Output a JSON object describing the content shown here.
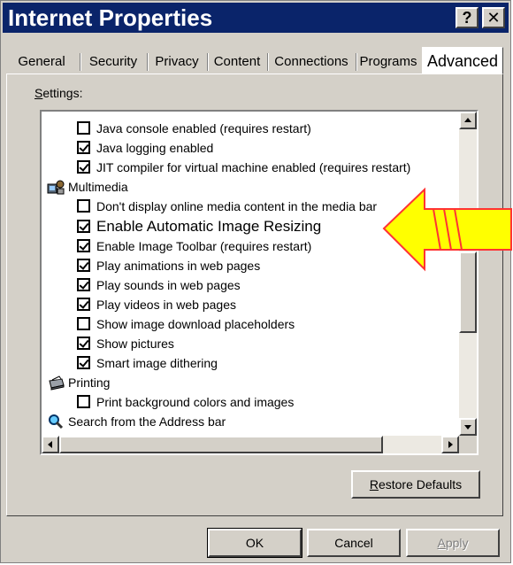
{
  "window": {
    "title": "Internet Properties",
    "help_glyph": "?",
    "close_glyph": "✕"
  },
  "tabs": [
    {
      "label": "General"
    },
    {
      "label": "Security"
    },
    {
      "label": "Privacy"
    },
    {
      "label": "Content"
    },
    {
      "label": "Connections"
    },
    {
      "label": "Programs"
    },
    {
      "label": "Advanced",
      "active": true
    }
  ],
  "settings_label": {
    "prefix": "S",
    "rest": "ettings:"
  },
  "settings": [
    {
      "type": "checkbox",
      "label": "Java console enabled (requires restart)",
      "checked": false
    },
    {
      "type": "checkbox",
      "label": "Java logging enabled",
      "checked": true
    },
    {
      "type": "checkbox",
      "label": "JIT compiler for virtual machine enabled (requires restart)",
      "checked": true
    },
    {
      "type": "category",
      "label": "Multimedia",
      "icon": "multimedia-icon"
    },
    {
      "type": "checkbox",
      "label": "Don't display online media content in the media bar",
      "checked": false
    },
    {
      "type": "checkbox",
      "label": "Enable Automatic Image Resizing",
      "checked": true,
      "highlight": true
    },
    {
      "type": "checkbox",
      "label": "Enable Image Toolbar (requires restart)",
      "checked": true
    },
    {
      "type": "checkbox",
      "label": "Play animations in web pages",
      "checked": true
    },
    {
      "type": "checkbox",
      "label": "Play sounds in web pages",
      "checked": true
    },
    {
      "type": "checkbox",
      "label": "Play videos in web pages",
      "checked": true
    },
    {
      "type": "checkbox",
      "label": "Show image download placeholders",
      "checked": false
    },
    {
      "type": "checkbox",
      "label": "Show pictures",
      "checked": true
    },
    {
      "type": "checkbox",
      "label": "Smart image dithering",
      "checked": true
    },
    {
      "type": "category",
      "label": "Printing",
      "icon": "printer-icon"
    },
    {
      "type": "checkbox",
      "label": "Print background colors and images",
      "checked": false
    },
    {
      "type": "category",
      "label": "Search from the Address bar",
      "icon": "search-icon"
    }
  ],
  "buttons": {
    "restore_prefix": "R",
    "restore_rest": "estore Defaults",
    "ok": "OK",
    "cancel": "Cancel",
    "apply_prefix": "A",
    "apply_rest": "pply"
  },
  "annotation": {
    "color": "#ffff00",
    "outline": "#ff3333",
    "icon": "arrow-left-icon"
  }
}
